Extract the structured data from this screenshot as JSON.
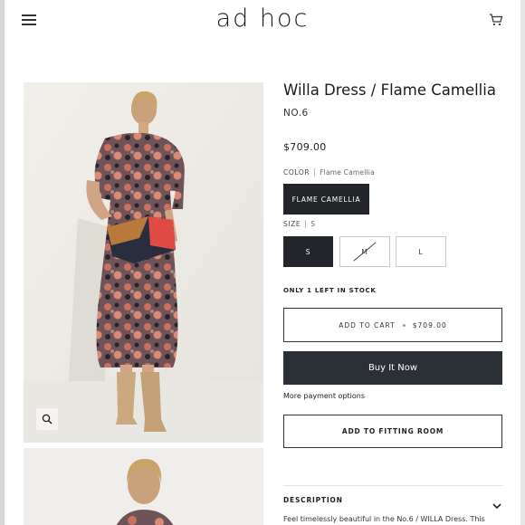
{
  "header": {
    "logo": "ad hoc",
    "menu_icon": "hamburger-menu-icon",
    "cart_icon": "shopping-cart-icon"
  },
  "gallery": {
    "zoom_icon": "magnifier-icon"
  },
  "product": {
    "title": "Willa Dress / Flame Camellia",
    "sku": "NO.6",
    "price": "$709.00",
    "color": {
      "label": "COLOR",
      "selected": "Flame Camellia",
      "options": [
        "FLAME CAMELLIA"
      ]
    },
    "size": {
      "label": "SIZE",
      "selected": "S",
      "options": [
        {
          "label": "S",
          "state": "selected"
        },
        {
          "label": "M",
          "state": "unavailable"
        },
        {
          "label": "L",
          "state": "available"
        }
      ]
    },
    "stock": "ONLY 1 LEFT IN STOCK",
    "add_to_cart": {
      "label": "ADD TO CART",
      "price": "$709.00"
    },
    "buy_now": "Buy It Now",
    "more_payment": "More payment options",
    "fitting_room": "ADD TO FITTING ROOM",
    "description": {
      "label": "DESCRIPTION",
      "text": "Feel timelessly beautiful in the No.6 / WILLA Dress. This"
    }
  },
  "colors": {
    "dark_button": "#2b3036",
    "selected_swatch": "#22262a"
  }
}
